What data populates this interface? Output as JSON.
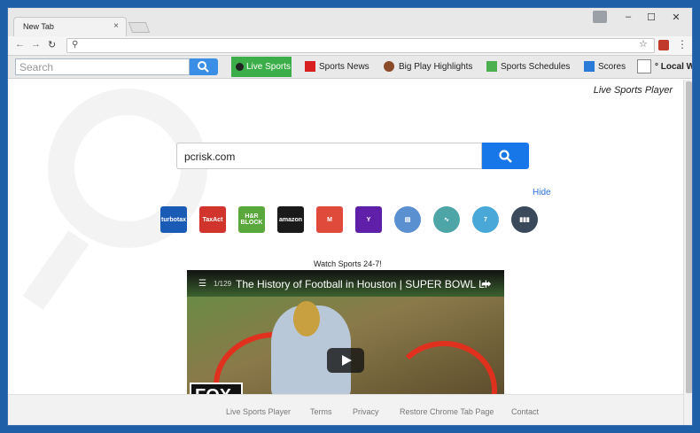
{
  "browser": {
    "tab_title": "New Tab",
    "tab_close": "×",
    "window_controls": [
      "–",
      "☐",
      "✕"
    ]
  },
  "toolbar": {
    "search_placeholder": "Search",
    "live_sports": "Live Sports",
    "sports_news": "Sports News",
    "big_play": "Big Play Highlights",
    "sports_schedules": "Sports Schedules",
    "scores": "Scores",
    "local_weather": "° Local We"
  },
  "page": {
    "player_label": "Live Sports Player",
    "search_value": "pcrisk.com",
    "hide": "Hide",
    "tiles": [
      {
        "name": "turbotax",
        "label": "turbotax",
        "color": "#1a5bb5"
      },
      {
        "name": "taxact",
        "label": "TaxAct",
        "color": "#d0342c"
      },
      {
        "name": "hr-block",
        "label": "H&R BLOCK",
        "color": "#5aa83c"
      },
      {
        "name": "amazon",
        "label": "amazon",
        "color": "#1a1a1a"
      },
      {
        "name": "gmail",
        "label": "M",
        "color": "#e04a3a"
      },
      {
        "name": "yahoo",
        "label": "Y",
        "color": "#5f1fa8"
      },
      {
        "name": "news",
        "label": "▤",
        "color": "#5a8fd0"
      },
      {
        "name": "stocks",
        "label": "∿",
        "color": "#4ea5a8"
      },
      {
        "name": "calendar",
        "label": "7",
        "color": "#4aa8d8"
      },
      {
        "name": "charts",
        "label": "▮▮▮",
        "color": "#3a4a5a"
      }
    ],
    "watch_label": "Watch Sports 24-7!",
    "video": {
      "count": "1/129",
      "title": "The History of Football in Houston | SUPER BOWL LI",
      "badge": "FOX"
    }
  },
  "footer": {
    "links": [
      "Live Sports Player",
      "Terms",
      "Privacy",
      "Restore Chrome Tab Page",
      "Contact"
    ]
  }
}
